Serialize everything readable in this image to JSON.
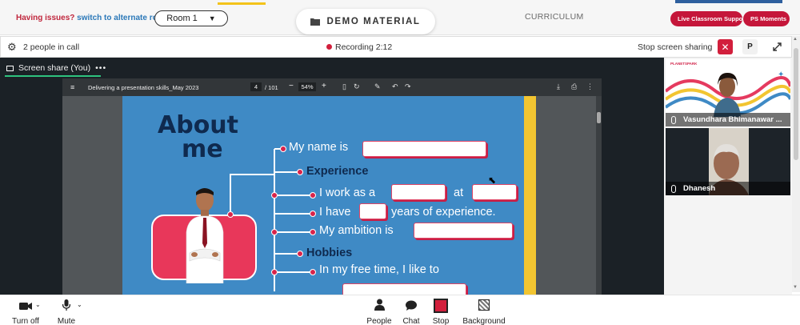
{
  "topbar": {
    "issues_text": "Having issues?",
    "alternate_link": "switch to alternate room",
    "room_value": "Room 1",
    "demo_tab_label": "DEMO MATERIAL",
    "curriculum_label": "CURRICULUM",
    "live_support_label": "Live Classroom Support",
    "ps_moments_label": "PS Moments"
  },
  "callbar": {
    "people_in_call": "2 people in call",
    "recording_label": "Recording",
    "recording_time": "2:12",
    "stop_sharing_label": "Stop screen sharing",
    "close_glyph": "✕",
    "p_label": "P"
  },
  "share": {
    "tab_label": "Screen share (You)",
    "more_glyph": "•••"
  },
  "pdf": {
    "doc_title": "Delivering a presentation skills_May 2023",
    "current_page": "4",
    "total_pages": "/ 101",
    "zoom": "54%"
  },
  "slide": {
    "title_line1": "About",
    "title_line2": "me",
    "name_line": "My name is",
    "experience_heading": "Experience",
    "work_as": "I work as a",
    "at": "at",
    "i_have": "I have",
    "years_exp": "years of experience.",
    "ambition": "My ambition is",
    "hobbies_heading": "Hobbies",
    "free_time": "In my free time, I like to"
  },
  "videos": {
    "tile1_name": "Vasundhara Bhimanawar ...",
    "tile2_name": "Dhanesh",
    "logo_text": "PLANETSPARK"
  },
  "bottombar": {
    "turn_off": "Turn off",
    "mute": "Mute",
    "people": "People",
    "chat": "Chat",
    "stop": "Stop",
    "background": "Background"
  },
  "colors": {
    "accent_red": "#d21f3c",
    "slide_blue": "#3f8ac5",
    "slide_navy": "#0f2a4f",
    "slide_yellow": "#f2c531",
    "share_green": "#2ec27e"
  },
  "icons": [
    "gear-icon",
    "record-dot-icon",
    "close-icon",
    "expand-icon",
    "folder-icon",
    "camera-icon",
    "microphone-icon",
    "person-icon",
    "chat-bubble-icon",
    "stop-share-icon",
    "background-icon",
    "mouse-cursor-icon"
  ]
}
